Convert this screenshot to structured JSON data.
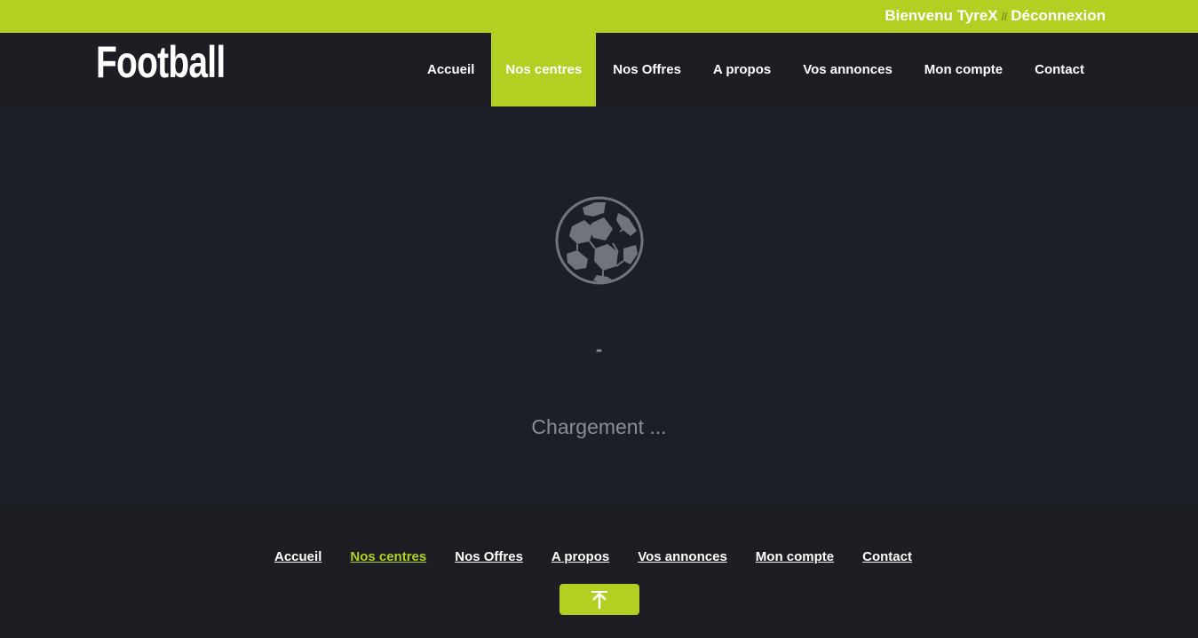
{
  "topbar": {
    "welcome": "Bienvenu TyreX",
    "separator": "//",
    "logout": "Déconnexion"
  },
  "header": {
    "logo": "Football",
    "nav": [
      {
        "label": "Accueil",
        "active": false
      },
      {
        "label": "Nos centres",
        "active": true
      },
      {
        "label": "Nos Offres",
        "active": false
      },
      {
        "label": "A propos",
        "active": false
      },
      {
        "label": "Vos annonces",
        "active": false
      },
      {
        "label": "Mon compte",
        "active": false
      },
      {
        "label": "Contact",
        "active": false
      }
    ]
  },
  "main": {
    "dash": "-",
    "loading_text": "Chargement ...",
    "ball_icon": "soccer-ball-icon"
  },
  "footer": {
    "links": [
      {
        "label": "Accueil",
        "active": false
      },
      {
        "label": "Nos centres",
        "active": true
      },
      {
        "label": "Nos Offres",
        "active": false
      },
      {
        "label": "A propos",
        "active": false
      },
      {
        "label": "Vos annonces",
        "active": false
      },
      {
        "label": "Mon compte",
        "active": false
      },
      {
        "label": "Contact",
        "active": false
      }
    ],
    "back_to_top_icon": "arrow-up-icon"
  },
  "colors": {
    "accent": "#b3d022",
    "header_bg": "#1d1d24",
    "main_bg": "#1b2028",
    "muted_text": "#8a8e94"
  }
}
